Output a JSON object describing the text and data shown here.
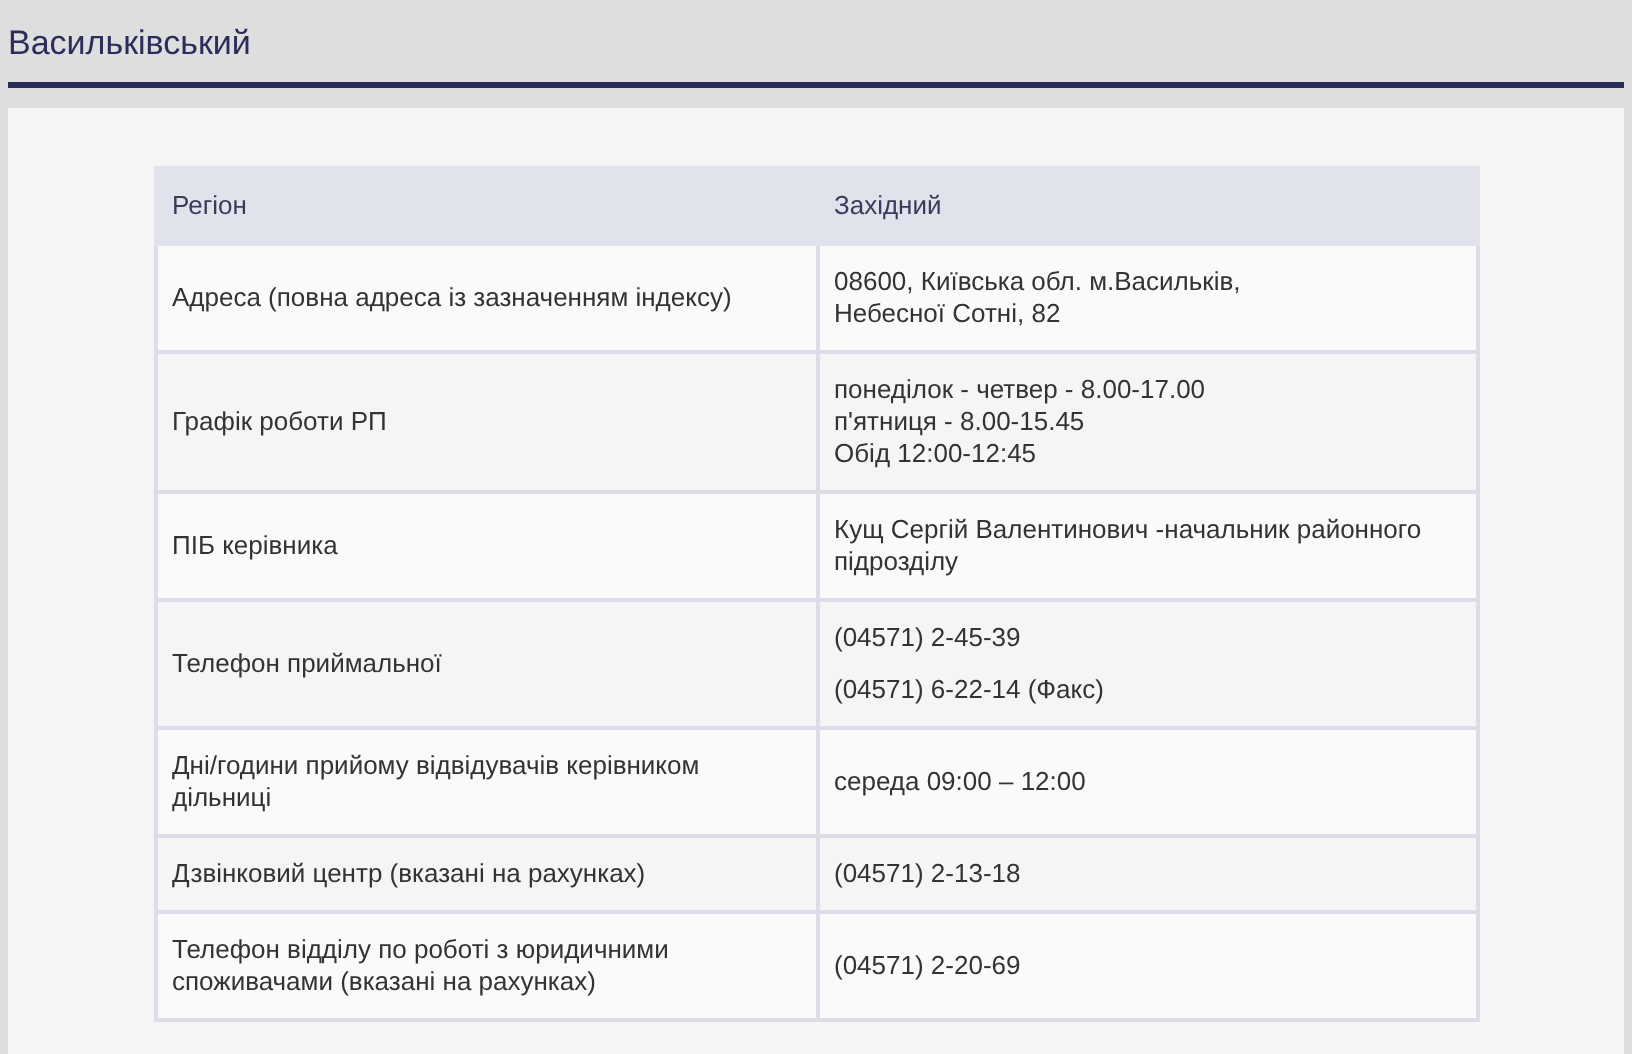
{
  "title": "Васильківський",
  "table": {
    "header": [
      "Регіон",
      "Західний"
    ],
    "rows": [
      {
        "label": "Адреса (повна адреса із зазначенням індексу)",
        "kind": "lines",
        "value": [
          "08600, Київська обл. м.Васильків,",
          "Небесної Сотні, 82"
        ]
      },
      {
        "label": "Графік роботи РП",
        "kind": "lines",
        "value": [
          "понеділок - четвер - 8.00-17.00",
          "п'ятниця - 8.00-15.45",
          "Обід 12:00-12:45"
        ]
      },
      {
        "label": "ПІБ  керівника",
        "kind": "lines",
        "value": [
          "Кущ Сергій Валентинович -начальник районного підрозділу"
        ]
      },
      {
        "label": "Телефон приймальної",
        "kind": "paragraphs",
        "value": [
          "(04571) 2-45-39",
          "(04571) 6-22-14 (Факс)"
        ]
      },
      {
        "label": "Дні/години прийому відвідувачів керівником дільниці",
        "kind": "lines",
        "value": [
          "середа 09:00 – 12:00"
        ]
      },
      {
        "label": "Дзвінковий центр (вказані на рахунках)",
        "kind": "lines",
        "value": [
          "(04571) 2-13-18"
        ]
      },
      {
        "label": "Телефон відділу по роботі з юридичними споживачами (вказані на рахунках)",
        "kind": "lines",
        "value": [
          "(04571) 2-20-69"
        ]
      }
    ]
  }
}
